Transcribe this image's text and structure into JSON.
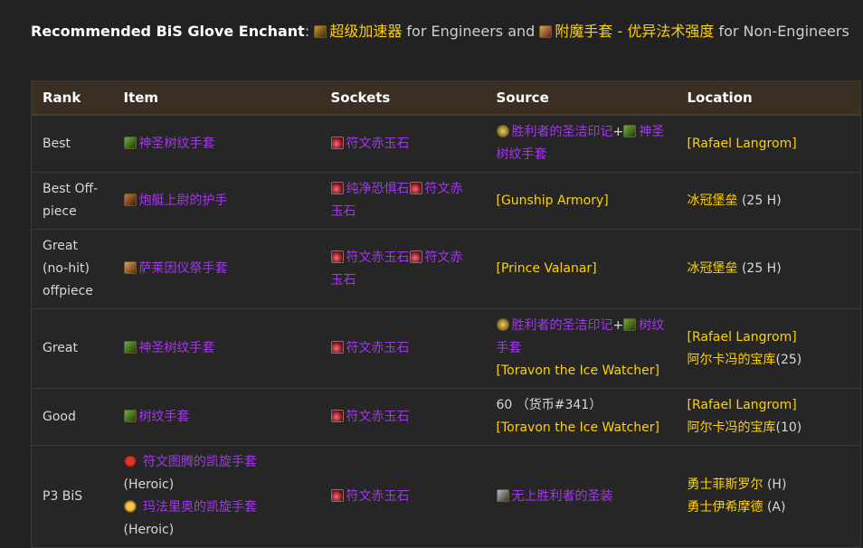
{
  "intro": {
    "lead": "Recommended BiS Glove Enchant",
    "colon": ":",
    "enchant_eng": "超级加速器",
    "for_eng": "for Engineers and",
    "enchant_non": "附魔手套 - 优异法术强度",
    "for_non": "for Non-Engineers"
  },
  "table": {
    "headers": [
      "Rank",
      "Item",
      "Sockets",
      "Source",
      "Location"
    ],
    "rows": [
      {
        "rank": "Best",
        "item": "神圣树纹手套",
        "sockets": [
          "符文赤玉石"
        ],
        "source_parts": [
          "胜利者的圣洁印记",
          "+",
          "神圣树纹手套"
        ],
        "location": [
          "[Rafael Langrom]"
        ]
      },
      {
        "rank": "Best Off-piece",
        "item": "炮艇上尉的护手",
        "sockets": [
          "纯净恐惧石",
          "符文赤玉石"
        ],
        "source": "[Gunship Armory]",
        "location_zone": "冰冠堡垒",
        "location_suffix": "(25 H)"
      },
      {
        "rank": "Great (no-hit) offpiece",
        "item": "萨莱因仪祭手套",
        "sockets": [
          "符文赤玉石",
          "符文赤玉石"
        ],
        "source": "[Prince Valanar]",
        "location_zone": "冰冠堡垒",
        "location_suffix": "(25 H)"
      },
      {
        "rank": "Great",
        "item": "神圣树纹手套",
        "sockets": [
          "符文赤玉石"
        ],
        "source_parts": [
          "胜利者的圣洁印记",
          "+",
          "树纹手套"
        ],
        "source_extra": "[Toravon the Ice Watcher]",
        "location": [
          "[Rafael Langrom]"
        ],
        "location_zone": "阿尔卡冯的宝库",
        "location_suffix": "(25)"
      },
      {
        "rank": "Good",
        "item": "树纹手套",
        "sockets": [
          "符文赤玉石"
        ],
        "source_cost": "60 （货币#341）",
        "source_extra": "[Toravon the Ice Watcher]",
        "location": [
          "[Rafael Langrom]"
        ],
        "location_zone": "阿尔卡冯的宝库",
        "location_suffix": "(10)"
      },
      {
        "rank": "P3 BiS",
        "items": [
          {
            "name": "符文图腾的凯旋手套",
            "note": "(Heroic)"
          },
          {
            "name": "玛法里奥的凯旋手套",
            "note": "(Heroic)"
          }
        ],
        "sockets": [
          "符文赤玉石"
        ],
        "source": "无上胜利者的圣装",
        "vendors": [
          {
            "name": "勇士菲斯罗尔",
            "suffix": "(H)"
          },
          {
            "name": "勇士伊希摩德",
            "suffix": "(A)"
          }
        ]
      }
    ]
  },
  "colors": {
    "background": "#222222",
    "header_bg": "#3a2f22",
    "epic_purple": "#a335ee",
    "legendary_gold": "#ffd100"
  }
}
